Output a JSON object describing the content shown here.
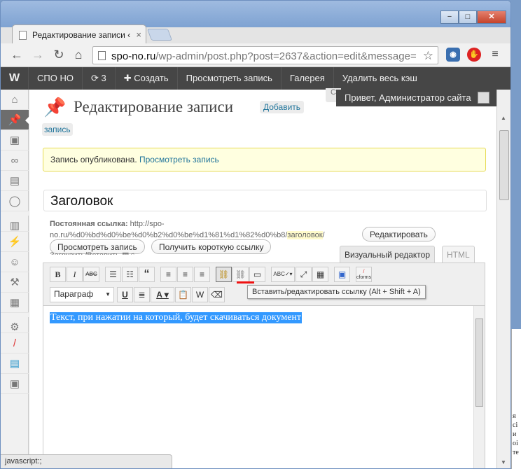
{
  "browser": {
    "tab_title": "Редактирование записи ‹",
    "tab_close": "×",
    "url_host": "spo-no.ru",
    "url_path": "/wp-admin/post.php?post=2637&action=edit&message=",
    "window_buttons": {
      "minimize": "−",
      "maximize": "□",
      "close": "✕"
    },
    "status": "javascript:;",
    "behind_text": "я\nсі\nи\nоі\nте"
  },
  "adminbar": {
    "items": [
      "СПО НО",
      "3",
      "Создать",
      "Просмотреть запись",
      "Галерея",
      "Удалить весь кэш"
    ],
    "howdy": "Привет, Администратор сайта"
  },
  "sidebar": {
    "icons": [
      "dashboard-icon",
      "posts-icon",
      "media-icon",
      "links-icon",
      "pages-icon",
      "comments-icon",
      "appearance-icon",
      "plugins-icon",
      "users-icon",
      "tools-icon",
      "settings-icon",
      "gear-icon",
      "cforms-icon",
      "form-icon",
      "gallery-icon"
    ]
  },
  "page": {
    "heading": "Редактирование записи",
    "add_new_1": "Добавить",
    "add_new_2": "запись",
    "notice_text": "Запись опубликована. ",
    "notice_link": "Просмотреть запись",
    "title_value": "Заголовок",
    "permalink_label": "Постоянная ссылка:",
    "permalink_url_1": " http://spo-",
    "permalink_url_2": "no.ru/%d0%bd%d0%be%d0%b2%d0%be%d1%81%d1%82%d0%b8/",
    "permalink_slug": "заголовок",
    "permalink_end": "/",
    "edit_button": "Редактировать",
    "view_button": "Просмотреть запись",
    "shortlink_button": "Получить короткую ссылку",
    "upload_label": "Загрузить/Вставить",
    "tab_visual": "Визуальный редактор",
    "tab_html": "HTML"
  },
  "editor": {
    "format_select": "Параграф",
    "tooltip": "Вставить/редактировать ссылку (Alt + Shift + A)",
    "content": "Текст, при нажатии на который, будет скачиваться документ",
    "cforms_label": "cforms"
  }
}
